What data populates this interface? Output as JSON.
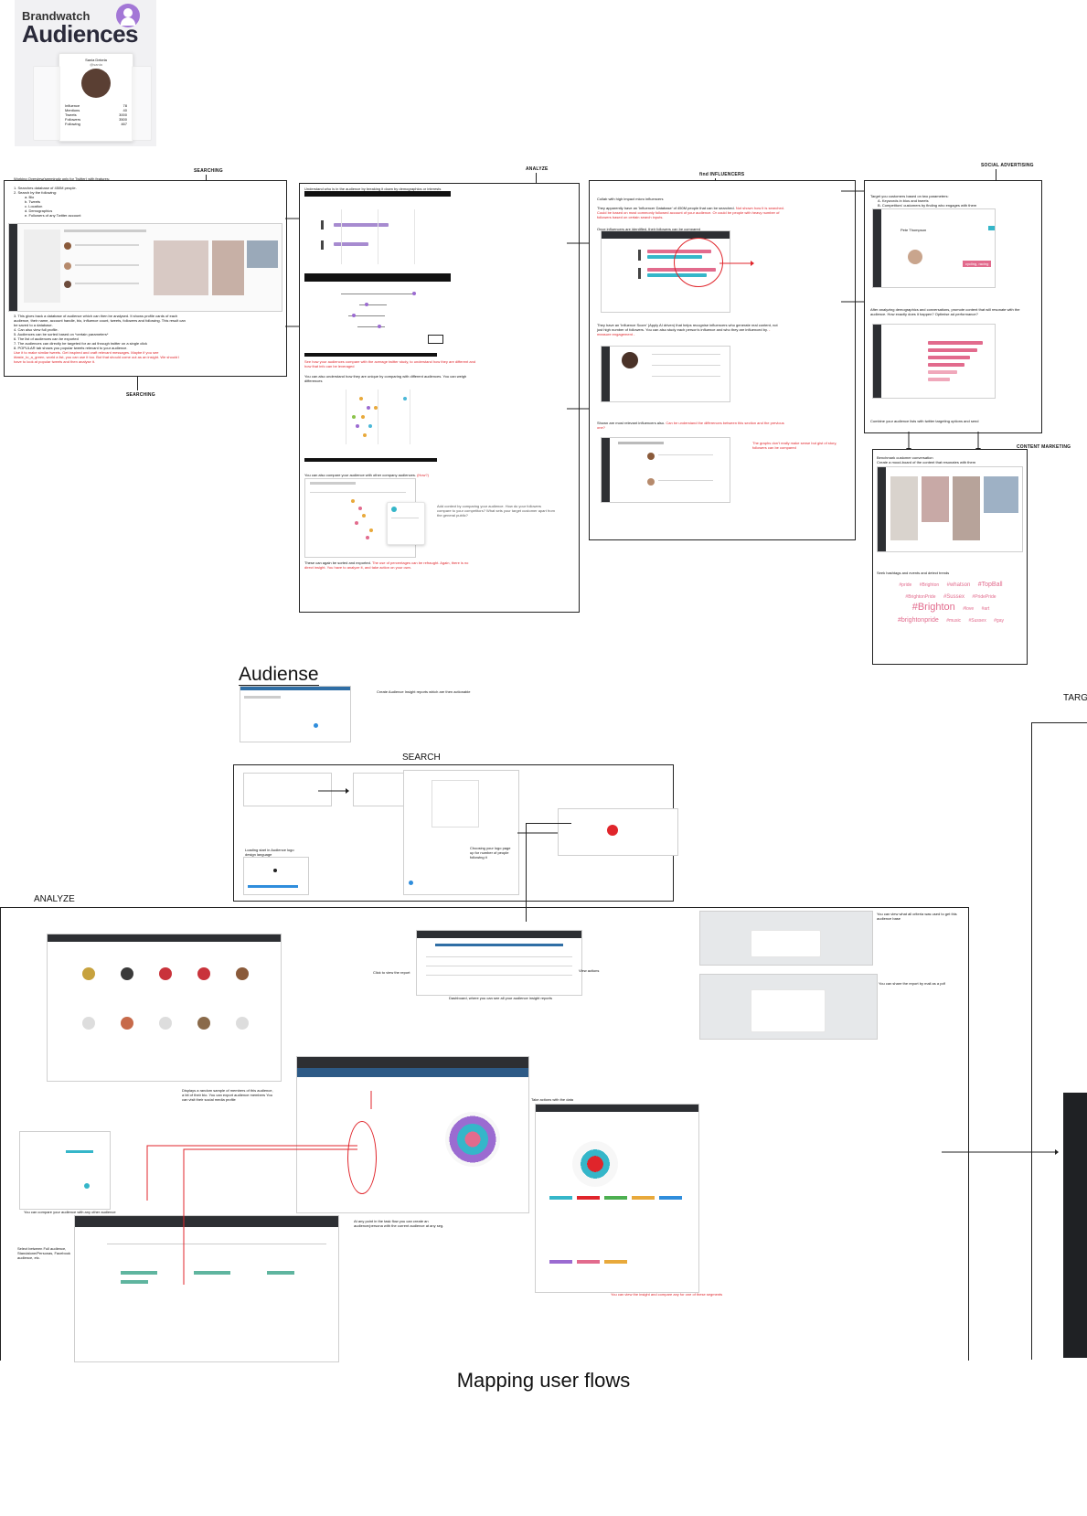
{
  "brandwatch": {
    "brand": "Brandwatch",
    "product": "Audiences",
    "profile_name": "Sania Dekela",
    "profile_handle": "@sania",
    "stats": [
      {
        "label": "Influence",
        "value": "78"
      },
      {
        "label": "Mentions",
        "value": "40"
      },
      {
        "label": "Tweets",
        "value": "3000"
      },
      {
        "label": "Followers",
        "value": "3500"
      },
      {
        "label": "Following",
        "value": "467"
      }
    ]
  },
  "sections": {
    "searching_top": "SEARCHING",
    "searching_bottom": "SEARCHING",
    "analyze": "ANALYZE",
    "find_influencers": "find INFLUENCERS",
    "social_advertising": "SOCIAL ADVERTISING",
    "content_marketing": "CONTENT MARKETING"
  },
  "searching": {
    "intro": "Working Overview(seemingly only for Twitter) with features:",
    "steps": [
      "1. Searches database of 450M people.",
      "2. Search by the following:",
      "a. Bio",
      "b. Tweets",
      "c. Location",
      "d. Demographics",
      "e. Followers of any Twitter account",
      "3. This gives back a database of audience which can then be analysed. It shows profile cards of each audience, their name, account handle, bio, influence count, tweets, followers and following. This result can be saved to a database.",
      "4. Can also view full profile.",
      "5. Audiences can be sorted based on *certain parameters*",
      "6. The list of audiences can be exported",
      "7. The audiences can directly be targeted for an ad through twitter on a single click",
      "8. POPULAR tab shows you popular tweets relevant to your audience."
    ],
    "red_note": "Use it to make similar tweets. Get inspired and craft relevant messages. Maybe if you see #taste_to_a_green, world a list, you can use it too. But that should come out as an insight. We should I have to look at popular tweets and then analyse it."
  },
  "analyze": {
    "heading": "Understand who is in the audience by breaking it down by demographics or interests",
    "red_compare": "See how your audiences compare with the average twitter study, to understand how they are different and how that info can be leveraged",
    "weigh": "You can also understand how they are unique by comparing with different audiences. You can weigh differences",
    "compare_other": "You can also compare your audience with other company audiences.",
    "compare_other_red": "(How?)",
    "context_note": "Add context by comparing your audience. How do your followers compare to your competitors? What sets your target customer apart from the general public?",
    "sorted": "These can again be sorted and exported.",
    "sorted_red": "The use of percentages can be refraught. Again, there is no direct insight. You have to analyze it, and take action on your own."
  },
  "influencers": {
    "intro": "Collab with high impact micro influencers",
    "database": "They apparently have an 'Influencer Database' of 450M people that can be searched.",
    "database_red": "Not shown how it is searched. Could be based on most commonly followed account of your audience. Or could be people with heavy number of followers based on certain search inputs.",
    "once": "Once influencers are identified, their followers can be compared",
    "influence_score": "They have an 'Influence Score' (Apply AI driven) that helps recognise influencers who generate real content, not just high number of followers. You can also study each person's influence and who they are influenced by.",
    "influence_score_red": "- measure engagement -",
    "shown": "Shown are most relevant influencers also.",
    "shown_red": "Can be understand the differences between this section and the previous one?",
    "graphs_red": "The graphs don't really make sense but gist of story, followers can be compared"
  },
  "social": {
    "intro": "Target you customers based on two parameters:",
    "a": "A. Keywords in bios and tweets",
    "b": "B. Competitors' customers by finding who engages with them",
    "profile_name": "Pete Thompson",
    "tag": "cycling, racing",
    "after": "After analyzing demographics and conversations, promote content that will resonate with the audience. How exactly does it happen? Optimise ad performance?",
    "combine": "Combine your audience lists with twitter targeting options and send"
  },
  "content": {
    "bench": "Benchmark customer conversation",
    "moodboard": "Create a mood-board of the content that resonates with them",
    "track": "Seek hashtags and events and detect trends",
    "words": [
      "#pride",
      "#Brighton",
      "#whatson",
      "#TopBall",
      "#BrightonPride",
      "#Sussex",
      "#PridePride",
      "#Brighton",
      "#love",
      "#art",
      "#brightonpride",
      "#music",
      "#Sussex",
      "#gay"
    ]
  },
  "audiense": {
    "title": "Audiense",
    "note": "Create Audience Insight reports which are then actionable",
    "search": "SEARCH",
    "analyze": "ANALYZE",
    "targ": "TARG",
    "login": "Loading start in Audience logo design language",
    "choose": "Choosing your logo page up for number of people following it",
    "click_report": "Click to view the report",
    "view_actions": "View actions",
    "dashboard": "Dashboard, where you can see all your audience insight reports",
    "criteria": "You can view what all criteria was used to get this audience base",
    "share": "You can share the report by mail as a pdf",
    "sample": "Displays a random sample of members of this audience, a bit of their bio. You can export audience members You can visit their social media profile",
    "compare": "You can compare your audience with any other audience",
    "select": "Select between Full audience, Standalone/Personas, Facebook audience, etc.",
    "segment": "At any point in the task flow you can create an audience/persona with the current audience at any seg.",
    "actions": "Take actions with the data",
    "insights_red": "You can view the insight and compare any for one of these segments"
  },
  "footer": {
    "title": "Mapping user flows"
  },
  "colors": {
    "accent_purple": "#9b6bd1",
    "pink": "#e26b8d",
    "red": "#e0252b",
    "teal": "#35b6c9",
    "dark": "#2d2f33"
  },
  "icons": [
    "user-circle-icon",
    "red-arrow-icon",
    "circle-highlight-icon"
  ]
}
